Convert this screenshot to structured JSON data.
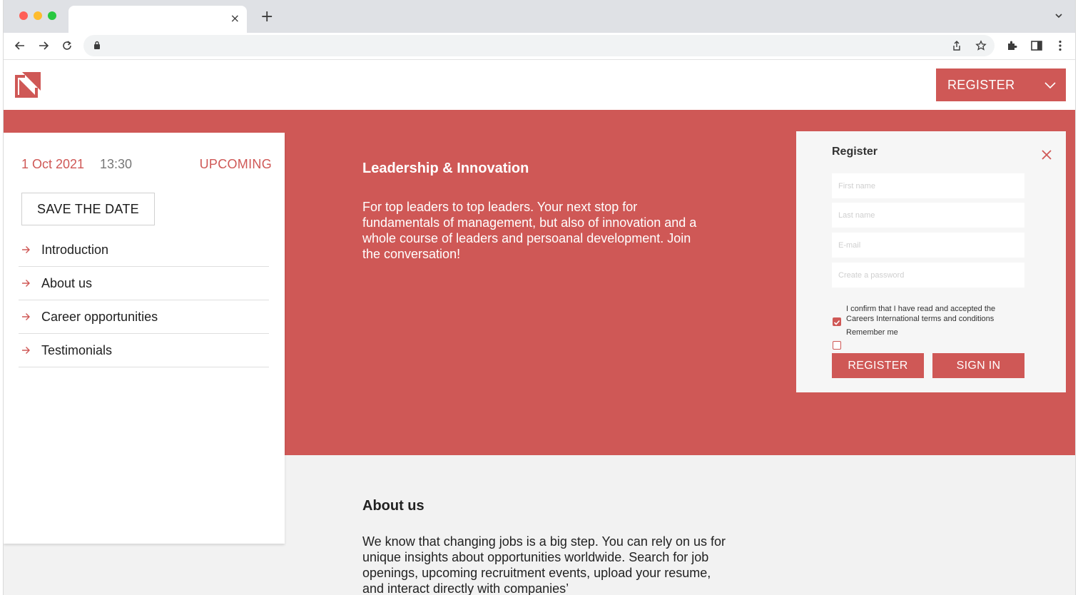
{
  "colors": {
    "accent": "#cf5856",
    "page_bg": "#f2f2f2",
    "card_bg": "#ffffff"
  },
  "browser": {
    "tab_title": "",
    "address": "",
    "icons": [
      "back-icon",
      "forward-icon",
      "reload-icon",
      "lock-icon",
      "share-icon",
      "bookmark-star-icon",
      "extensions-icon",
      "side-panel-icon",
      "more-menu-icon"
    ]
  },
  "header": {
    "register_label": "REGISTER"
  },
  "event": {
    "date": "1 Oct 2021",
    "time": "13:30",
    "status": "UPCOMING",
    "save_label": "SAVE THE DATE"
  },
  "nav": {
    "items": [
      {
        "label": "Introduction"
      },
      {
        "label": "About us"
      },
      {
        "label": "Career opportunities"
      },
      {
        "label": "Testimonials"
      }
    ]
  },
  "hero": {
    "title": "Leadership & Innovation",
    "body": "For top leaders to top leaders. Your next stop for fundamentals of management, but also of innovation and a whole course of leaders and persoanal development. Join the conversation!"
  },
  "register_panel": {
    "title": "Register",
    "first_name_placeholder": "First name",
    "last_name_placeholder": "Last name",
    "email_placeholder": "E-mail",
    "password_placeholder": "Create a password",
    "consent_text": "I confirm that I have read and accepted the Careers International terms and conditions",
    "consent_checked": true,
    "remember_text": "Remember me",
    "remember_checked": false,
    "register_label": "REGISTER",
    "signin_label": "SIGN IN"
  },
  "about": {
    "title": "About us",
    "body": "We know that changing jobs is a big step. You can rely on us for unique insights about opportunities worldwide. Search for job openings, upcoming recruitment events, upload your resume, and interact directly with companies’"
  }
}
